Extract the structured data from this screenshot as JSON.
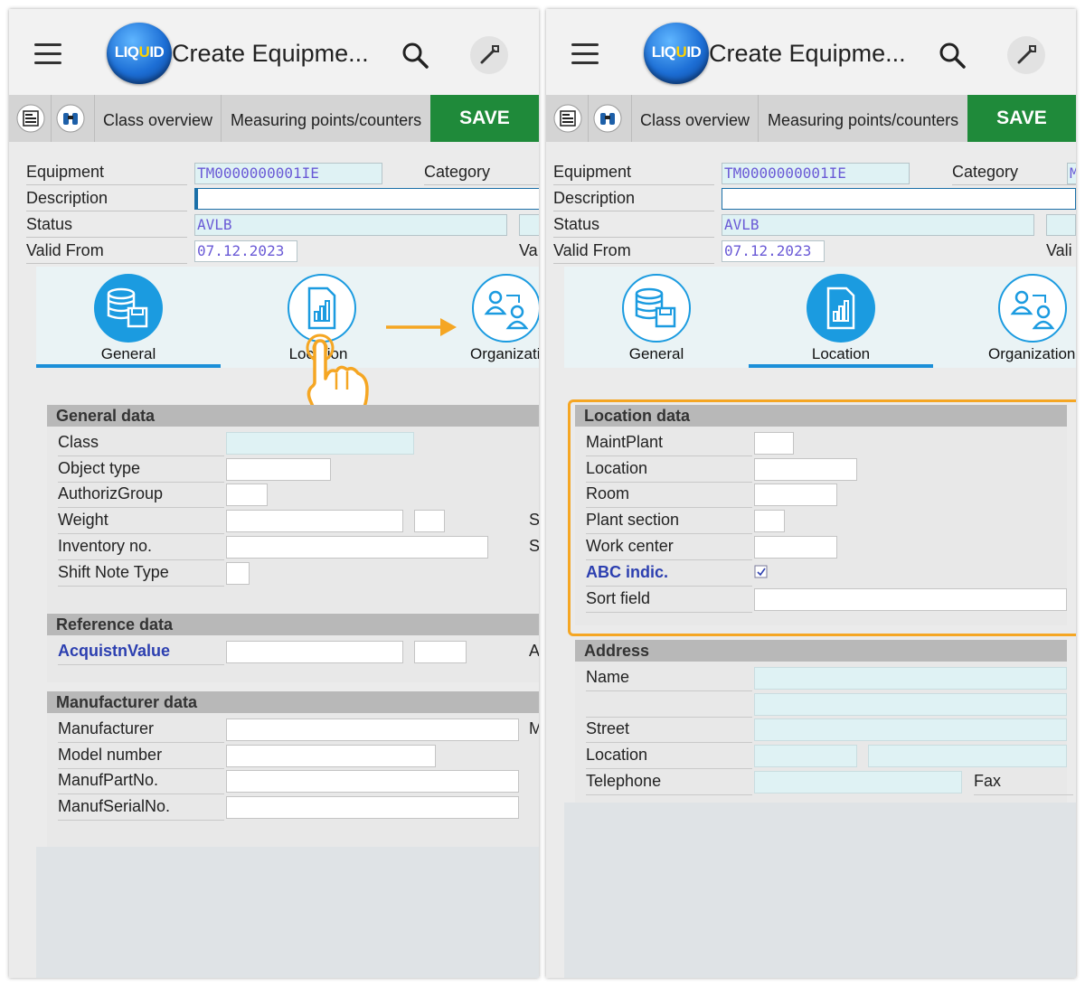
{
  "app": {
    "logo": {
      "part1": "LIQ",
      "part2": "U",
      "part3": "ID"
    },
    "title": "Create Equipme..."
  },
  "toolbar": {
    "class_overview": "Class overview",
    "measuring_points": "Measuring points/counters",
    "save": "SAVE"
  },
  "header": {
    "equipment_label": "Equipment",
    "equipment_value": "TM0000000001IE",
    "category_label": "Category",
    "category_value_cut": "M",
    "description_label": "Description",
    "status_label": "Status",
    "status_value": "AVLB",
    "valid_from_label": "Valid From",
    "valid_from_value": "07.12.2023",
    "valid_to_cut_left": "Va",
    "valid_to_cut_right": "Vali"
  },
  "tabs": {
    "general": "General",
    "location_cut": "Loc",
    "location_cut_end": "tion",
    "location": "Location",
    "organization_cut_left": "Organizatio",
    "organization_cut_right": "Organization"
  },
  "general_data": {
    "title": "General data",
    "fields": [
      "Class",
      "Object type",
      "AuthorizGroup",
      "Weight",
      "Inventory no.",
      "Shift Note Type"
    ],
    "edge_s1": "S",
    "edge_s2": "S"
  },
  "reference_data": {
    "title": "Reference data",
    "acquisition": "AcquistnValue",
    "edge_a": "A"
  },
  "manufacturer_data": {
    "title": "Manufacturer data",
    "fields": [
      "Manufacturer",
      "Model number",
      "ManufPartNo.",
      "ManufSerialNo."
    ],
    "edge_m": "M"
  },
  "location_data": {
    "title": "Location data",
    "fields": [
      "MaintPlant",
      "Location",
      "Room",
      "Plant section",
      "Work center",
      "ABC indic.",
      "Sort field"
    ],
    "abc_checked": true
  },
  "address": {
    "title": "Address",
    "fields": [
      "Name",
      "Street",
      "Location",
      "Telephone"
    ],
    "fax": "Fax"
  },
  "colors": {
    "save_green": "#1f8a3a",
    "accent_blue": "#1b9be0",
    "highlight_orange": "#f5a623",
    "link_blue": "#2c3fb0"
  }
}
